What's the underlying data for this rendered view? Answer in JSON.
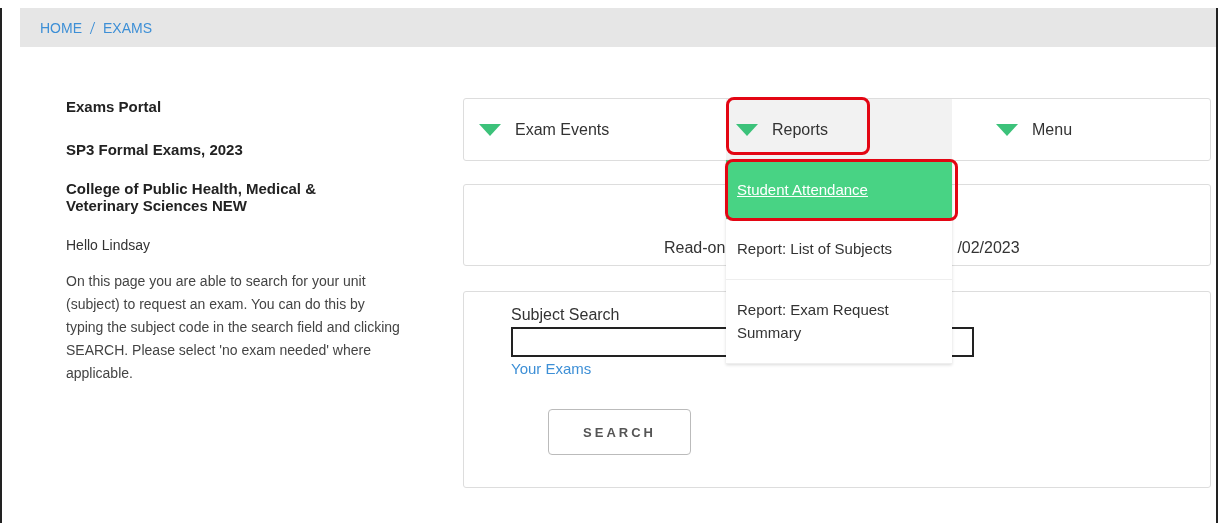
{
  "breadcrumb": [
    "HOME",
    "EXAMS"
  ],
  "info": {
    "title": "Exams Portal",
    "event": "SP3 Formal Exams, 2023",
    "college": "College of Public Health, Medical & Veterinary Sciences NEW",
    "greeting": "Hello Lindsay",
    "description": "On this page you are able to search for your unit (subject) to request an exam. You can do this by typing the subject code in the search field and clicking SEARCH. Please select 'no exam needed' where applicable."
  },
  "nav": [
    {
      "label": "Exam Events",
      "selected": false,
      "highlighted": false
    },
    {
      "label": "Reports",
      "selected": true,
      "highlighted": true
    },
    {
      "label": "Menu",
      "selected": false,
      "highlighted": false
    }
  ],
  "dropdown": [
    {
      "label": "Student Attendance",
      "selected": true,
      "highlighted": true
    },
    {
      "label": "Report: List of Subjects",
      "selected": false,
      "highlighted": false
    },
    {
      "label": "Report: Exam Request Summary",
      "selected": false,
      "highlighted": false
    }
  ],
  "notice": {
    "left": "Read-on",
    "right": "/02/2023"
  },
  "search": {
    "label": "Subject Search",
    "link": "Your Exams",
    "button": "SEARCH"
  }
}
